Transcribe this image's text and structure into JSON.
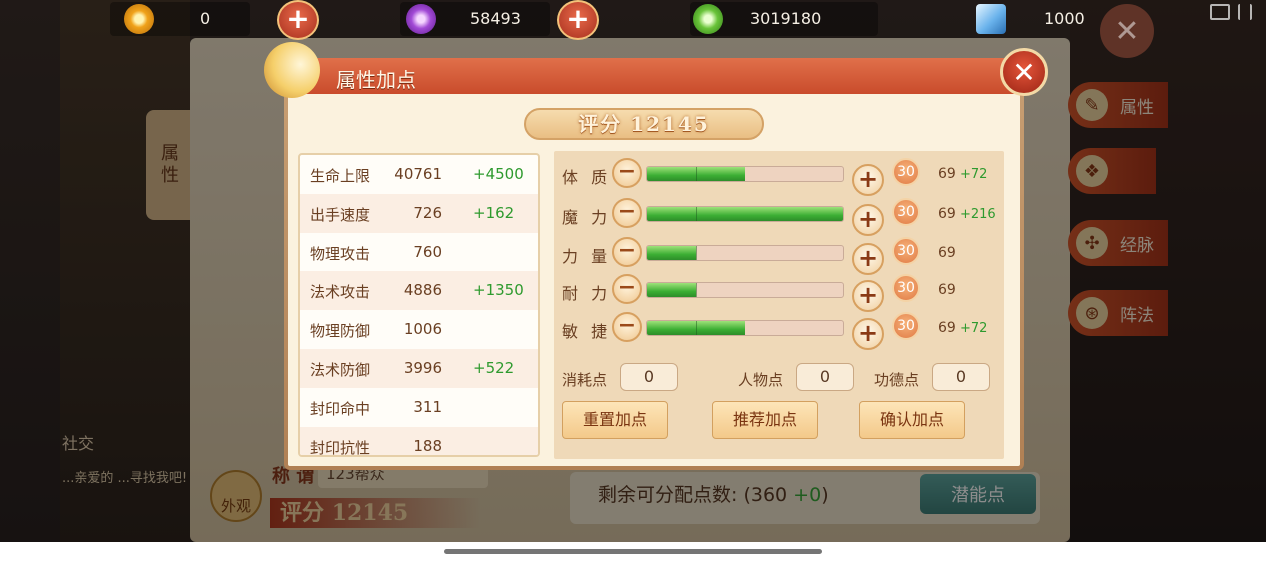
{
  "currencies": {
    "gold": {
      "value": "0",
      "icon": "gold-coin-icon"
    },
    "purple": {
      "value": "58493",
      "icon": "purple-gem-icon"
    },
    "green": {
      "value": "3019180",
      "icon": "jade-coin-icon"
    },
    "diamond": {
      "value": "1000",
      "icon": "diamond-icon"
    }
  },
  "background": {
    "vertical_tab": "属性",
    "side_tabs": [
      "属性",
      "",
      "经脉",
      "阵法"
    ],
    "remaining_label": "剩余可分配点数:",
    "remaining_value": "360",
    "remaining_bonus": "+0",
    "potential_button": "潜能点",
    "score_label": "评分",
    "score_value": "12145",
    "title_label": "称 谓",
    "title_value": "123帮众",
    "appearance_label": "外观",
    "social_label": "社交",
    "chat_text": "...亲爱的 ...寻找我吧!"
  },
  "modal": {
    "title": "属性加点",
    "score_label": "评分",
    "score_value": "12145",
    "stats": [
      {
        "name": "生命上限",
        "value": "40761",
        "bonus": "+4500"
      },
      {
        "name": "出手速度",
        "value": "726",
        "bonus": "+162"
      },
      {
        "name": "物理攻击",
        "value": "760",
        "bonus": ""
      },
      {
        "name": "法术攻击",
        "value": "4886",
        "bonus": "+1350"
      },
      {
        "name": "物理防御",
        "value": "1006",
        "bonus": ""
      },
      {
        "name": "法术防御",
        "value": "3996",
        "bonus": "+522"
      },
      {
        "name": "封印命中",
        "value": "311",
        "bonus": ""
      },
      {
        "name": "封印抗性",
        "value": "188",
        "bonus": ""
      }
    ],
    "attributes": [
      {
        "name": "体 质",
        "level": 0.5,
        "badge": "30",
        "base": "69",
        "bonus": "+72"
      },
      {
        "name": "魔 力",
        "level": 1.0,
        "badge": "30",
        "base": "69",
        "bonus": "+216"
      },
      {
        "name": "力 量",
        "level": 0.25,
        "badge": "30",
        "base": "69",
        "bonus": ""
      },
      {
        "name": "耐 力",
        "level": 0.25,
        "badge": "30",
        "base": "69",
        "bonus": ""
      },
      {
        "name": "敏 捷",
        "level": 0.5,
        "badge": "30",
        "base": "69",
        "bonus": "+72"
      }
    ],
    "points": {
      "consumed_label": "消耗点",
      "consumed_value": "0",
      "character_label": "人物点",
      "character_value": "0",
      "merit_label": "功德点",
      "merit_value": "0"
    },
    "buttons": {
      "reset": "重置加点",
      "recommend": "推荐加点",
      "confirm": "确认加点"
    }
  }
}
